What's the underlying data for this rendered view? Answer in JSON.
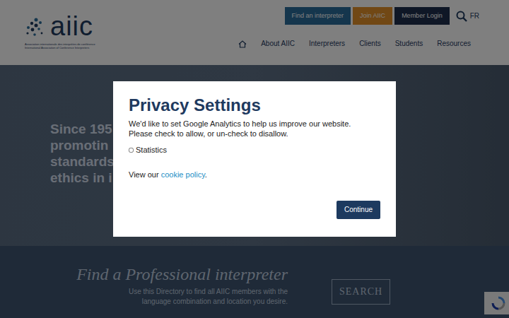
{
  "header": {
    "logo": {
      "text": "aiic",
      "tagline": [
        "Association internationale des interprètes de conférence",
        "International Association of Conference Interpreters"
      ]
    },
    "top_buttons": [
      {
        "label": "Find an interpreter",
        "color": "#2b6d9a"
      },
      {
        "label": "Join AIIC",
        "color": "#e3902a"
      },
      {
        "label": "Member Login",
        "color": "#1f2f4d"
      }
    ],
    "language": "FR",
    "nav": [
      "About AIIC",
      "Interpreters",
      "Clients",
      "Students",
      "Resources"
    ]
  },
  "hero": {
    "heading_lines": [
      "Since 195",
      "promotin",
      "standards",
      "ethics in i"
    ]
  },
  "directory": {
    "title": "Find a Professional interpreter",
    "description": "Use this Directory to find all AIIC members with the language combination and location you desire.",
    "button": "SEARCH"
  },
  "modal": {
    "title": "Privacy Settings",
    "text": "We'd like to set Google Analytics to help us improve our website. Please check to allow, or un-check to disallow.",
    "options": [
      {
        "label": "Statistics",
        "checked": false
      }
    ],
    "policy_prefix": "View our",
    "policy_link": "cookie policy",
    "policy_suffix": ".",
    "button": "Continue"
  }
}
